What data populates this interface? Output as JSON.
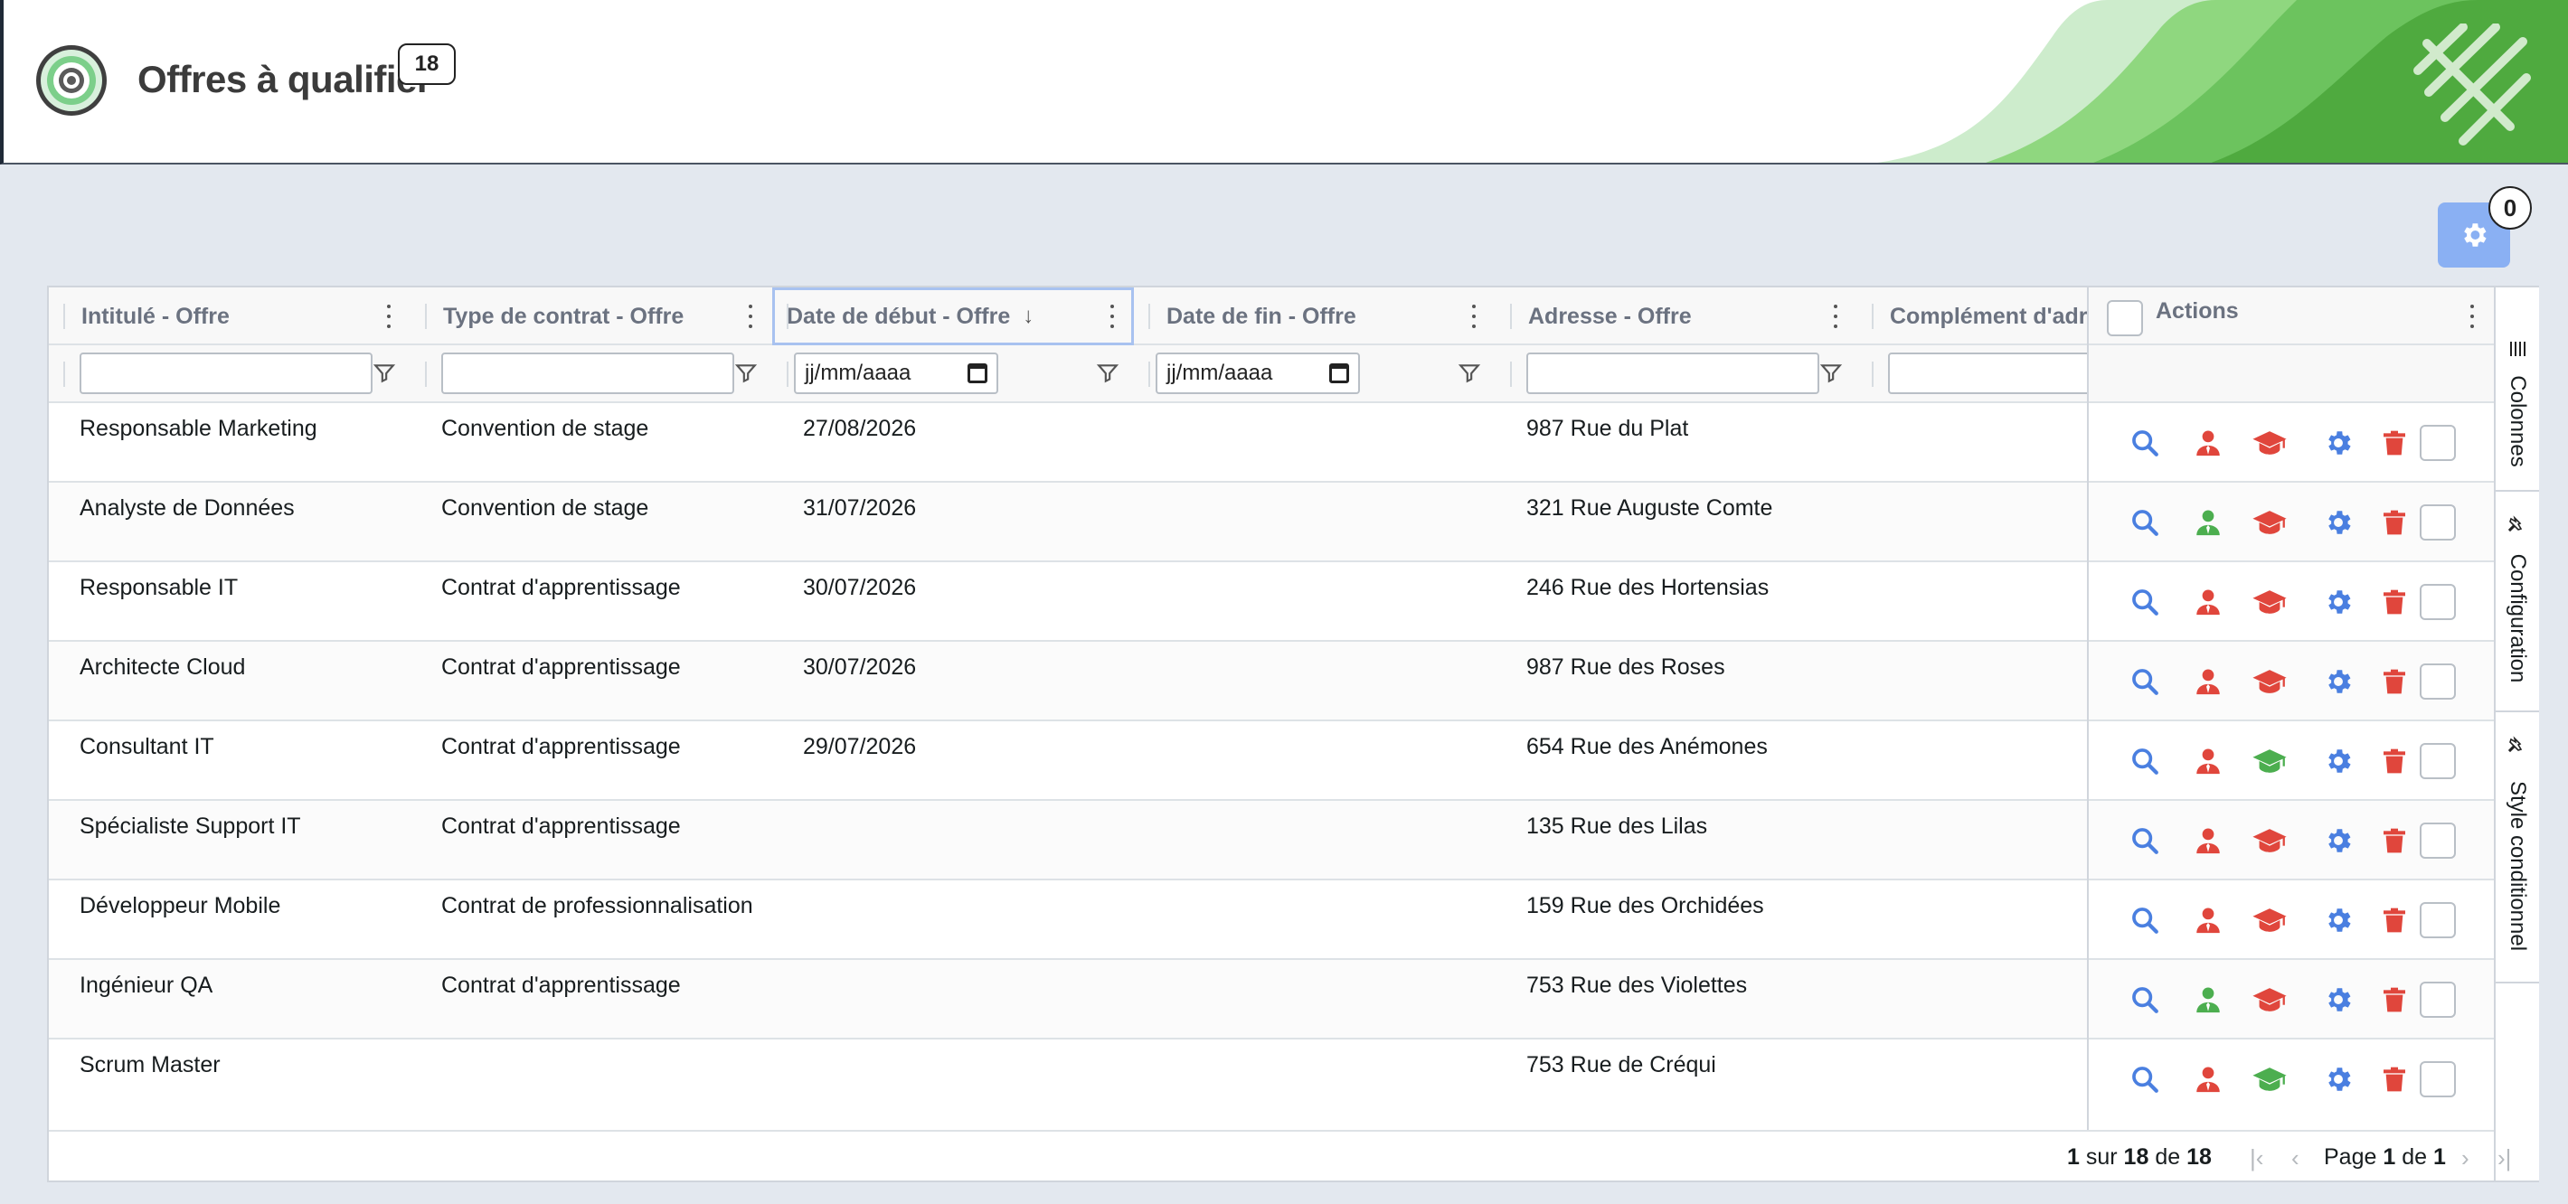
{
  "header": {
    "title": "Offres à qualifier",
    "count_badge": "18",
    "settings_count": "0"
  },
  "colors": {
    "accent_blue": "#4a7fe0",
    "danger_red": "#e0463c",
    "success_green": "#4cae4f",
    "settings_btn": "#8ab0f3"
  },
  "grid": {
    "columns": [
      {
        "label": "Intitulé - Offre",
        "filter": "text"
      },
      {
        "label": "Type de contrat - Offre",
        "filter": "text"
      },
      {
        "label": "Date de début - Offre",
        "filter": "date",
        "sorted": "desc"
      },
      {
        "label": "Date de fin - Offre",
        "filter": "date"
      },
      {
        "label": "Adresse - Offre",
        "filter": "text"
      },
      {
        "label": "Complément d'adr",
        "filter": "text"
      }
    ],
    "date_placeholder": "jj/mm/aaaa",
    "actions_header": "Actions",
    "rows": [
      {
        "intitule": "Responsable Marketing",
        "type": "Convention de stage",
        "debut": "27/08/2026",
        "fin": "",
        "adresse": "987 Rue du Plat",
        "person": "red",
        "cap": "red"
      },
      {
        "intitule": "Analyste de Données",
        "type": "Convention de stage",
        "debut": "31/07/2026",
        "fin": "",
        "adresse": "321 Rue Auguste Comte",
        "person": "green",
        "cap": "red"
      },
      {
        "intitule": "Responsable IT",
        "type": "Contrat d'apprentissage",
        "debut": "30/07/2026",
        "fin": "",
        "adresse": "246 Rue des Hortensias",
        "person": "red",
        "cap": "red"
      },
      {
        "intitule": "Architecte Cloud",
        "type": "Contrat d'apprentissage",
        "debut": "30/07/2026",
        "fin": "",
        "adresse": "987 Rue des Roses",
        "person": "red",
        "cap": "red"
      },
      {
        "intitule": "Consultant IT",
        "type": "Contrat d'apprentissage",
        "debut": "29/07/2026",
        "fin": "",
        "adresse": "654 Rue des Anémones",
        "person": "red",
        "cap": "green"
      },
      {
        "intitule": "Spécialiste Support IT",
        "type": "Contrat d'apprentissage",
        "debut": "",
        "fin": "",
        "adresse": "135 Rue des Lilas",
        "person": "red",
        "cap": "red"
      },
      {
        "intitule": "Développeur Mobile",
        "type": "Contrat de professionnalisation",
        "debut": "",
        "fin": "",
        "adresse": "159 Rue des Orchidées",
        "person": "red",
        "cap": "red"
      },
      {
        "intitule": "Ingénieur QA",
        "type": "Contrat d'apprentissage",
        "debut": "",
        "fin": "",
        "adresse": "753 Rue des Violettes",
        "person": "green",
        "cap": "red"
      },
      {
        "intitule": "Scrum Master",
        "type": "",
        "debut": "",
        "fin": "",
        "adresse": "753 Rue de Créqui",
        "person": "red",
        "cap": "green"
      }
    ]
  },
  "side_panel": {
    "tabs": [
      "Colonnes",
      "Configuration",
      "Style conditionnel"
    ]
  },
  "paging": {
    "from": "1",
    "sur": "sur",
    "to": "18",
    "de": "de",
    "total": "18",
    "page_word": "Page",
    "page": "1",
    "pages": "1"
  }
}
